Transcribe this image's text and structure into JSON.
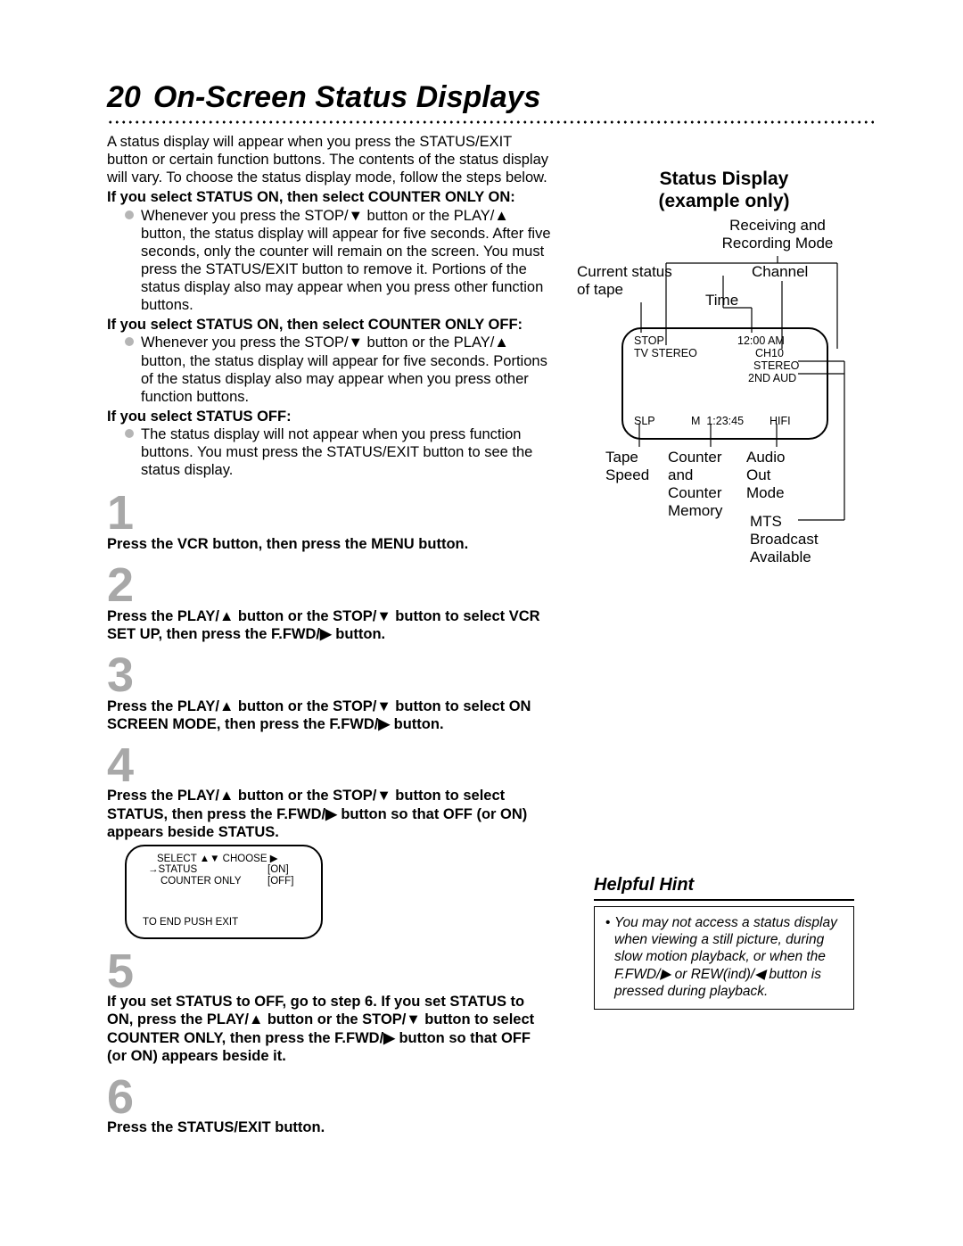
{
  "page_number": "20",
  "page_title": "On-Screen Status Displays",
  "intro": "A status display will appear when you press the STATUS/EXIT button or certain function buttons. The contents of the status display will vary. To choose the status display mode, follow the steps below.",
  "sections": [
    {
      "heading": "If you select STATUS ON, then select COUNTER ONLY ON:",
      "bullet": "Whenever you press the STOP/▼ button or the PLAY/▲ button, the status display will appear for five seconds. After five seconds, only the counter will remain on the screen. You must press the STATUS/EXIT button to remove it. Portions of the status display also may appear when you press other function buttons."
    },
    {
      "heading": "If you select STATUS ON, then select COUNTER ONLY OFF:",
      "bullet": "Whenever you press the STOP/▼ button or the PLAY/▲ button, the status display will appear for five seconds. Portions of the status display also may appear when you press other function buttons."
    },
    {
      "heading": "If you select STATUS OFF:",
      "bullet": "The status display will not appear when you press function buttons. You must press the STATUS/EXIT button to see the status display."
    }
  ],
  "steps": [
    "Press the VCR button, then press the MENU button.",
    "Press the PLAY/▲ button or the STOP/▼ button to select VCR SET UP, then press the F.FWD/▶ button.",
    "Press the PLAY/▲ button or the STOP/▼ button to select ON SCREEN MODE, then press the F.FWD/▶ button.",
    "Press the PLAY/▲ button or the STOP/▼ button to select STATUS, then press the F.FWD/▶ button so that OFF (or ON) appears beside STATUS.",
    "If you set STATUS to OFF, go to step 6. If you set STATUS to ON, press the PLAY/▲ button or the STOP/▼ button to select COUNTER ONLY, then press the F.FWD/▶ button so that OFF (or ON) appears beside it.",
    "Press the STATUS/EXIT button."
  ],
  "menu_screen": {
    "header": "SELECT ▲▼  CHOOSE ▶",
    "row1_left": "→STATUS",
    "row1_right": "[ON]",
    "row2_left": "COUNTER ONLY",
    "row2_right": "[OFF]",
    "footer": "TO END PUSH EXIT"
  },
  "status_heading": "Status Display\n(example only)",
  "status_labels": {
    "receiving": "Receiving and\nRecording Mode",
    "channel": "Channel",
    "time": "Time",
    "current_status": "Current status\nof tape",
    "tape_speed": "Tape\nSpeed",
    "counter": "Counter\nand\nCounter\nMemory",
    "audio": "Audio\nOut\nMode",
    "mts": "MTS\nBroadcast\nAvailable"
  },
  "tv_screen": {
    "top_left1": "STOP",
    "top_left2": "TV STEREO",
    "top_right1": "12:00 AM",
    "top_right2": "CH10",
    "top_right3": "STEREO",
    "top_right4": "2ND AUD",
    "bot_left": "SLP",
    "bot_mid": "M  1:23:45",
    "bot_right": "HIFI"
  },
  "hint": {
    "title": "Helpful Hint",
    "body": "You may not access a status display when viewing a still picture, during slow motion playback, or when the F.FWD/▶ or REW(ind)/◀ button is pressed during playback."
  }
}
